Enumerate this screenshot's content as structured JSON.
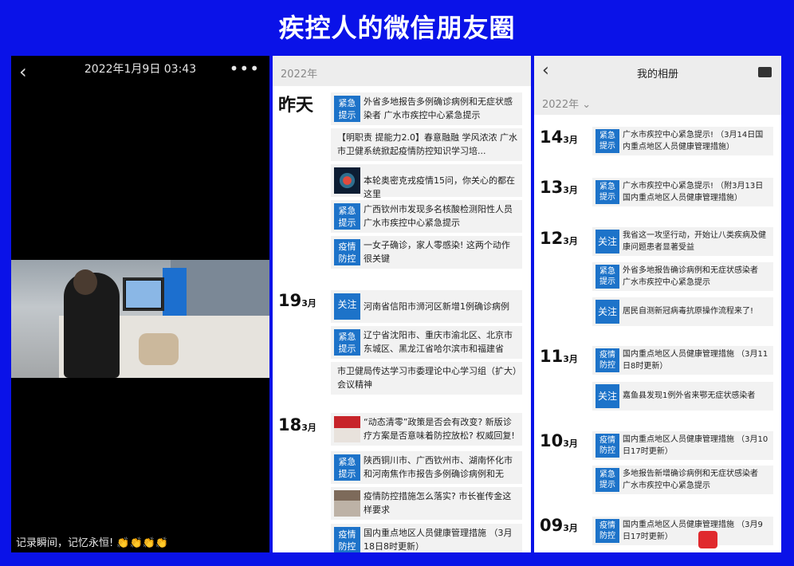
{
  "page_title": "疾控人的微信朋友圈",
  "panel1": {
    "back_icon": "chevron-left-icon",
    "datetime": "2022年1月9日 03:43",
    "more_icon": "ellipsis-icon",
    "caption": "记录瞬间，记忆永恒!",
    "caption_emoji": "👏👏👏👏"
  },
  "panel2": {
    "year": "2022年",
    "groups": [
      {
        "label": "昨天",
        "items": [
          {
            "tag": "紧急\n提示",
            "text": "外省多地报告多例确诊病例和无症状感染者 广水市疾控中心紧急提示"
          },
          {
            "tag": "",
            "text": "【明职责 提能力2.0】春意融融 学风浓浓 广水市卫健系统掀起疫情防控知识学习培..."
          },
          {
            "tag": "",
            "thumb": "virus",
            "text": "本轮奥密克戎疫情15问，你关心的都在这里"
          },
          {
            "tag": "紧急\n提示",
            "text": "广西钦州市发现多名核酸检测阳性人员 广水市疾控中心紧急提示"
          },
          {
            "tag": "疫情\n防控",
            "text": "一女子确诊，家人零感染! 这两个动作很关键"
          }
        ]
      },
      {
        "day": "19",
        "month": "3月",
        "items": [
          {
            "tag": "关注",
            "text": "河南省信阳市浉河区新增1例确诊病例"
          },
          {
            "tag": "紧急\n提示",
            "text": "辽宁省沈阳市、重庆市渝北区、北京市东城区、黑龙江省哈尔滨市和福建省莆..."
          },
          {
            "tag": "",
            "text": "市卫健局传达学习市委理论中心学习组（扩大）会议精神"
          }
        ]
      },
      {
        "day": "18",
        "month": "3月",
        "items": [
          {
            "tag": "",
            "thumb": "meet1",
            "text": "“动态清零”政策是否会有改变? 新版诊疗方案是否意味着防控放松? 权威回复!"
          },
          {
            "tag": "紧急\n提示",
            "text": "陕西铜川市、广西钦州市、湖南怀化市和河南焦作市报告多例确诊病例和无症..."
          },
          {
            "tag": "",
            "thumb": "meet2",
            "text": "疫情防控措施怎么落实? 市长崔传金这样要求"
          },
          {
            "tag": "疫情\n防控",
            "text": "国内重点地区人员健康管理措施 （3月18日8时更新）"
          }
        ]
      }
    ]
  },
  "panel3": {
    "back_icon": "chevron-left-icon",
    "title": "我的相册",
    "message_icon": "message-icon",
    "year": "2022年 ⌄",
    "groups": [
      {
        "day": "14",
        "month": "3月",
        "items": [
          {
            "tag": "紧急\n提示",
            "text": "广水市疾控中心紧急提示! （3月14日国内重点地区人员健康管理措施）"
          }
        ]
      },
      {
        "day": "13",
        "month": "3月",
        "items": [
          {
            "tag": "紧急\n提示",
            "text": "广水市疾控中心紧急提示! （附3月13日国内重点地区人员健康管理措施）"
          }
        ]
      },
      {
        "day": "12",
        "month": "3月",
        "items": [
          {
            "tag": "关注",
            "text": "我省这一攻坚行动，开始让八类疾病及健康问题患者显著受益"
          },
          {
            "tag": "紧急\n提示",
            "text": "外省多地报告确诊病例和无症状感染者 广水市疾控中心紧急提示"
          },
          {
            "tag": "关注",
            "text": "居民自测新冠病毒抗原操作流程来了!"
          }
        ]
      },
      {
        "day": "11",
        "month": "3月",
        "items": [
          {
            "tag": "疫情\n防控",
            "text": "国内重点地区人员健康管理措施 （3月11日8时更新）"
          },
          {
            "tag": "关注",
            "text": "嘉鱼县发现1例外省来鄂无症状感染者"
          }
        ]
      },
      {
        "day": "10",
        "month": "3月",
        "items": [
          {
            "tag": "疫情\n防控",
            "text": "国内重点地区人员健康管理措施 （3月10日17时更新）"
          },
          {
            "tag": "紧急\n提示",
            "text": "多地报告新增确诊病例和无症状感染者 广水市疾控中心紧急提示"
          }
        ]
      },
      {
        "day": "09",
        "month": "3月",
        "items": [
          {
            "tag": "疫情\n防控",
            "text": "国内重点地区人员健康管理措施 （3月9日17时更新）"
          }
        ]
      }
    ]
  },
  "colors": {
    "background": "#0a12e8",
    "tag_blue": "#1d73c9"
  }
}
